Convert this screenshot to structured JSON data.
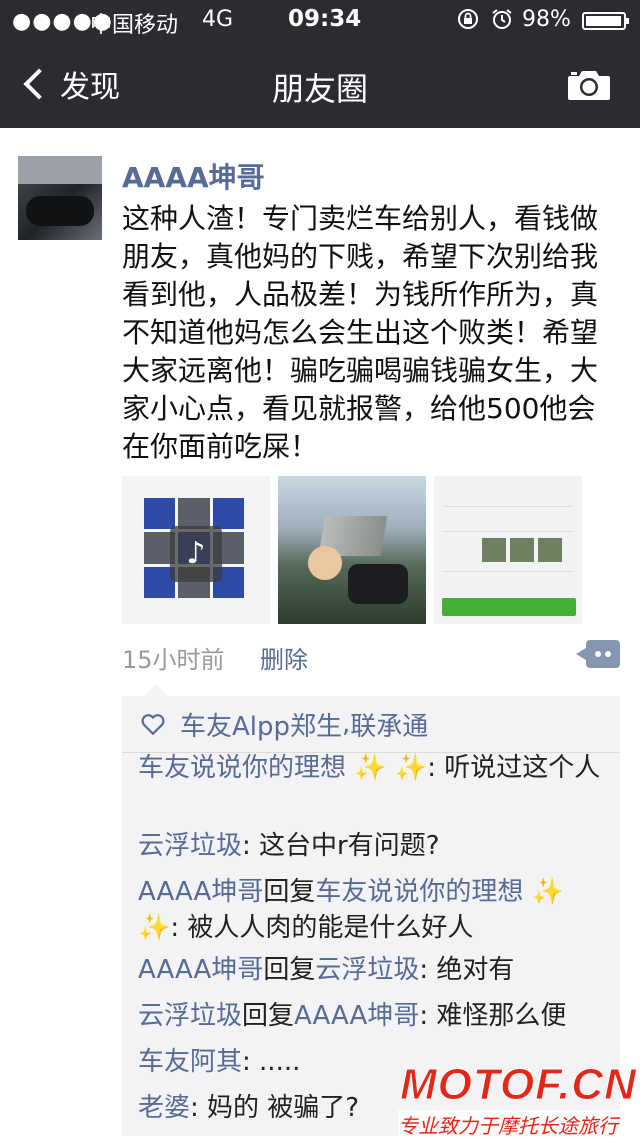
{
  "status_bar": {
    "signal": "●●●●●",
    "carrier": "中国移动",
    "network": "4G",
    "time": "09:34",
    "lock_icon": "lock-rotation-icon",
    "alarm_icon": "alarm-icon",
    "battery_percent": "98%",
    "battery_level": 0.98
  },
  "nav": {
    "back_label": "发现",
    "title": "朋友圈",
    "camera_icon": "camera-icon"
  },
  "post": {
    "author": "AAAA坤哥",
    "text": "这种人渣！专门卖烂车给别人，看钱做朋友，真他妈的下贱，希望下次别给我看到他，人品极差！为钱所作所为，真不知道他妈怎么会生出这个败类！希望大家远离他！骗吃骗喝骗钱骗女生，大家小心点，看见就报警，给他500他会在你面前吃屎！",
    "time_ago": "15小时前",
    "delete_label": "删除",
    "photos": [
      {
        "name": "photo-screenshot-bike-listing"
      },
      {
        "name": "photo-selfie-motorcycles"
      },
      {
        "name": "photo-profile-screenshot"
      }
    ]
  },
  "likes": {
    "names": [
      "车友Alpp郑生",
      "联承通"
    ],
    "separator": ", "
  },
  "comments": [
    {
      "author": "车友说说你的理想 ✨ ✨",
      "reply_label": "",
      "reply_to": "",
      "text": ": 听说过这个人"
    },
    {
      "author": "云浮垃圾",
      "reply_label": "",
      "reply_to": "",
      "text": ": 这台中r有问题?"
    },
    {
      "author": "AAAA坤哥",
      "reply_label": "回复",
      "reply_to": "车友说说你的理想 ✨ ✨",
      "text": ": 被人人肉的能是什么好人"
    },
    {
      "author": "AAAA坤哥",
      "reply_label": "回复",
      "reply_to": "云浮垃圾",
      "text": ": 绝对有"
    },
    {
      "author": "云浮垃圾",
      "reply_label": "回复",
      "reply_to": "AAAA坤哥",
      "text": ": 难怪那么便"
    },
    {
      "author": "车友阿其",
      "reply_label": "",
      "reply_to": "",
      "text": ": ....."
    },
    {
      "author": "老婆",
      "reply_label": "",
      "reply_to": "",
      "text": ": 妈的 被骗了?"
    }
  ],
  "watermark": {
    "logo": "MOTOF.CN",
    "tagline": "专业致力于摩托长途旅行"
  },
  "colors": {
    "nav_bg": "#2b2c30",
    "name_link": "#576b95",
    "comment_bg": "#f3f3f5",
    "watermark_red": "#e62617"
  }
}
